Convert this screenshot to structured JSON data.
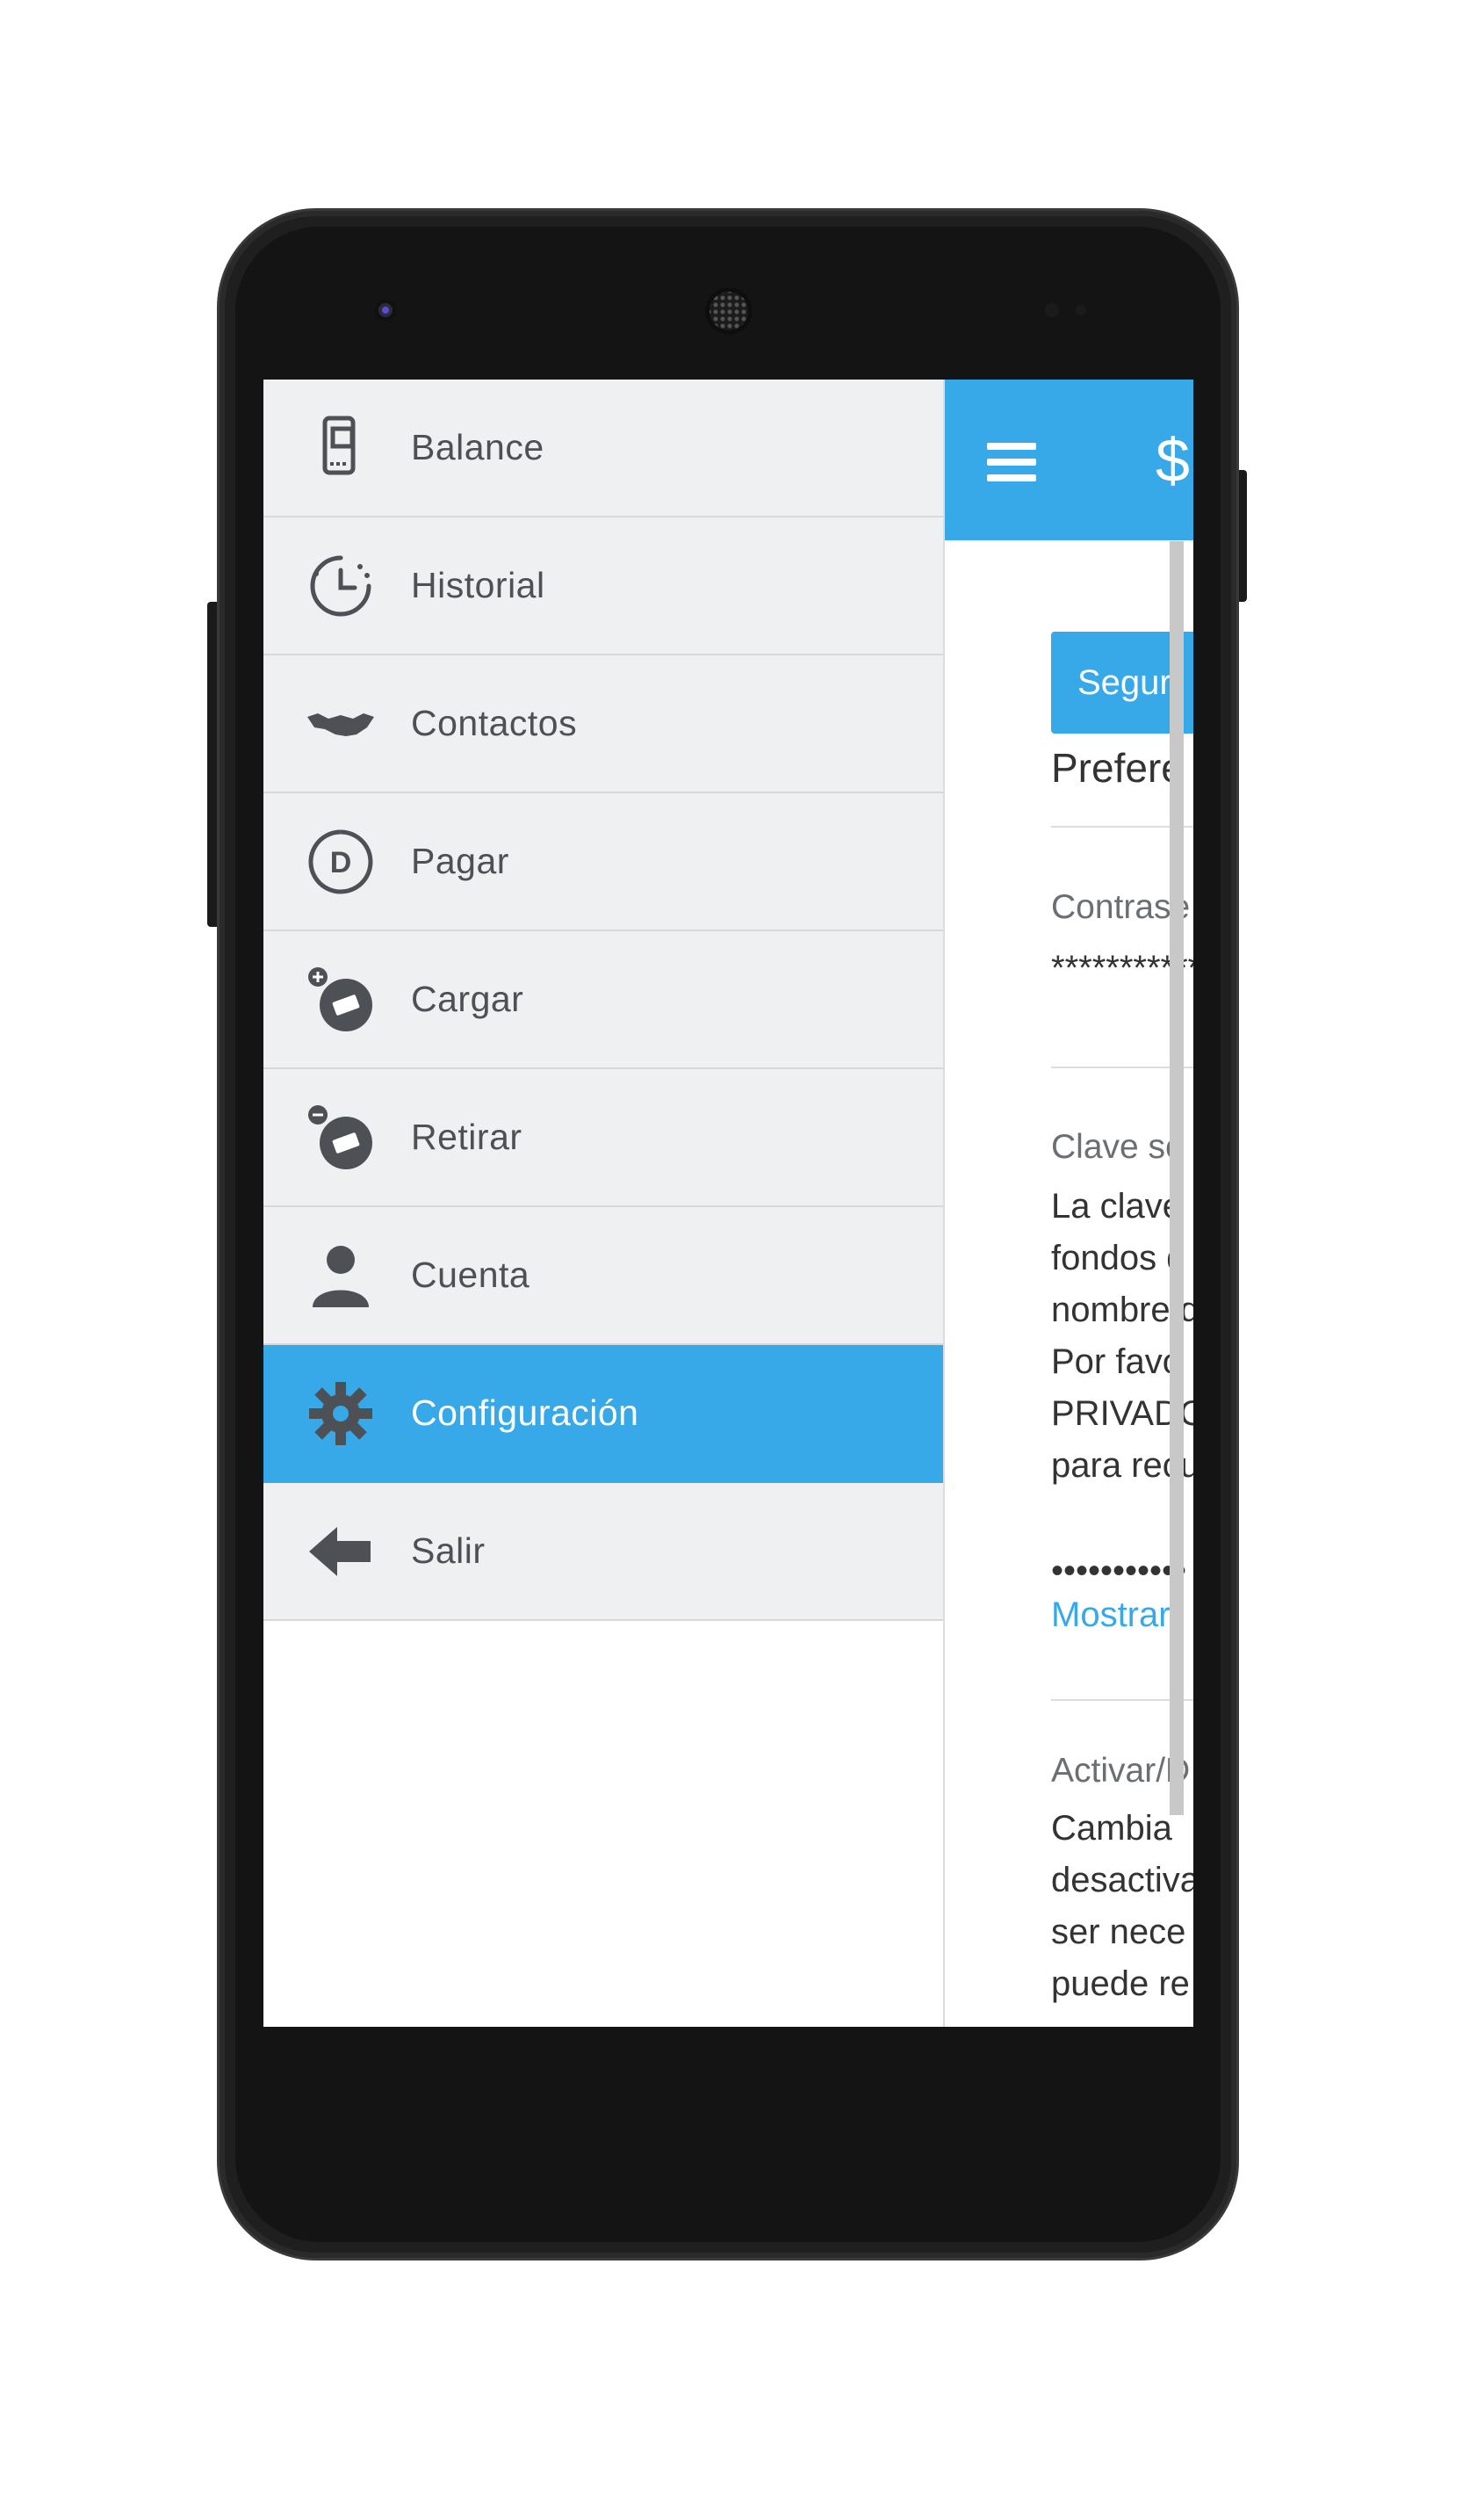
{
  "drawer": {
    "items": [
      {
        "label": "Balance",
        "icon": "balance-phone-icon"
      },
      {
        "label": "Historial",
        "icon": "history-clock-icon"
      },
      {
        "label": "Contactos",
        "icon": "handshake-icon"
      },
      {
        "label": "Pagar",
        "icon": "pay-coin-icon"
      },
      {
        "label": "Cargar",
        "icon": "load-money-icon"
      },
      {
        "label": "Retirar",
        "icon": "withdraw-money-icon"
      },
      {
        "label": "Cuenta",
        "icon": "user-icon"
      },
      {
        "label": "Configuración",
        "icon": "gear-icon",
        "active": true
      },
      {
        "label": "Salir",
        "icon": "arrow-left-icon"
      }
    ]
  },
  "main": {
    "header": {
      "balance_peek": "$"
    },
    "tab_label": "Seguri",
    "section_title": "Prefere",
    "password": {
      "label": "Contrase",
      "value": "***********"
    },
    "secret_key": {
      "label": "Clave se",
      "lines": [
        "La clave",
        "fondos d",
        "nombre d",
        "Por favo",
        "PRIVADO",
        "para recu"
      ],
      "masked": "•••••••••••",
      "show_link": "Mostrar"
    },
    "toggle_section": {
      "label": "Activar/D",
      "lines": [
        "Cambia",
        "desactiva",
        "ser nece",
        "puede re"
      ]
    }
  },
  "colors": {
    "accent": "#37a9e8",
    "drawer_bg": "#eef0f2",
    "text": "#4d5156"
  }
}
